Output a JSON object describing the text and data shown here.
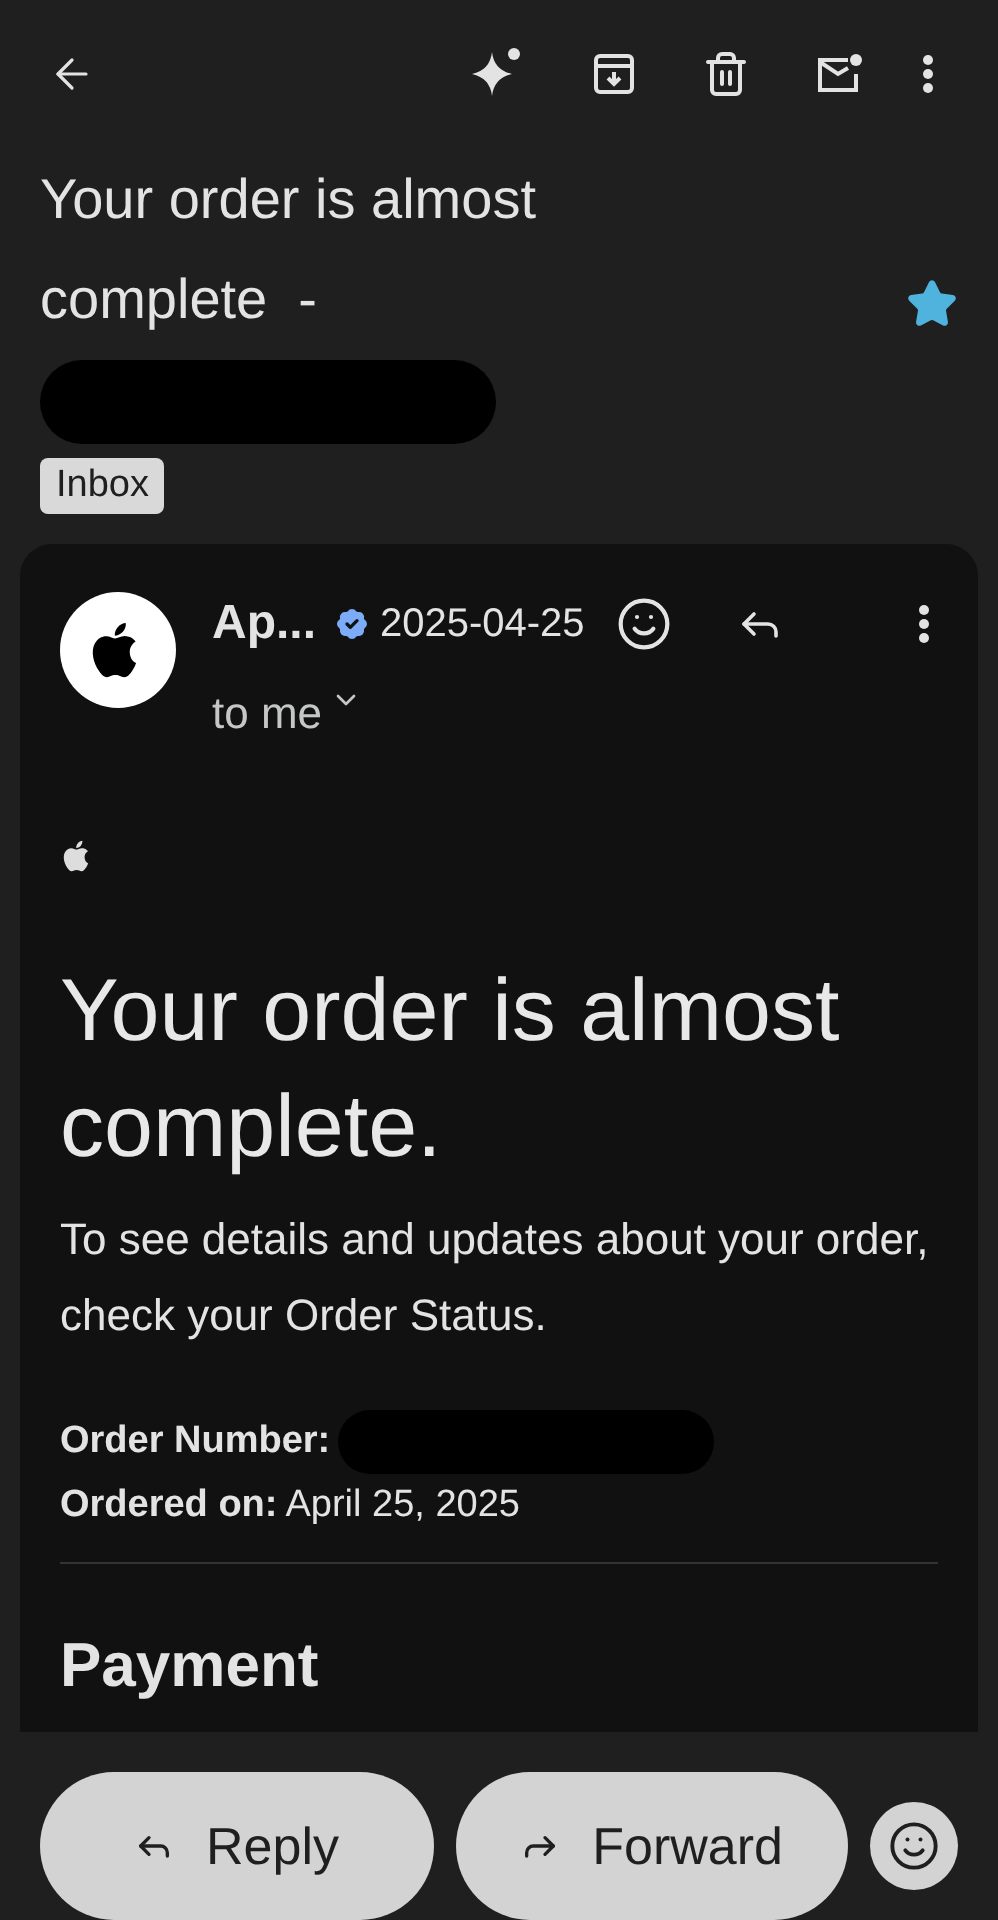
{
  "subject": {
    "text": "Your order is almost complete  -",
    "redacted": true,
    "starred": true
  },
  "label": "Inbox",
  "message": {
    "sender": "Ap...",
    "verified": true,
    "date": "2025-04-25",
    "recipient": "to me",
    "heading": "Your order is almost complete.",
    "intro": "To see details and updates about your order, check your Order Status.",
    "details": [
      {
        "label": "Order Number:",
        "redacted": true
      },
      {
        "label": "Ordered on:",
        "value": "April 25, 2025",
        "redacted": false
      }
    ],
    "section": "Payment"
  },
  "actions": [
    {
      "label": "Reply",
      "kind": "reply"
    },
    {
      "label": "Forward",
      "kind": "forward"
    }
  ]
}
